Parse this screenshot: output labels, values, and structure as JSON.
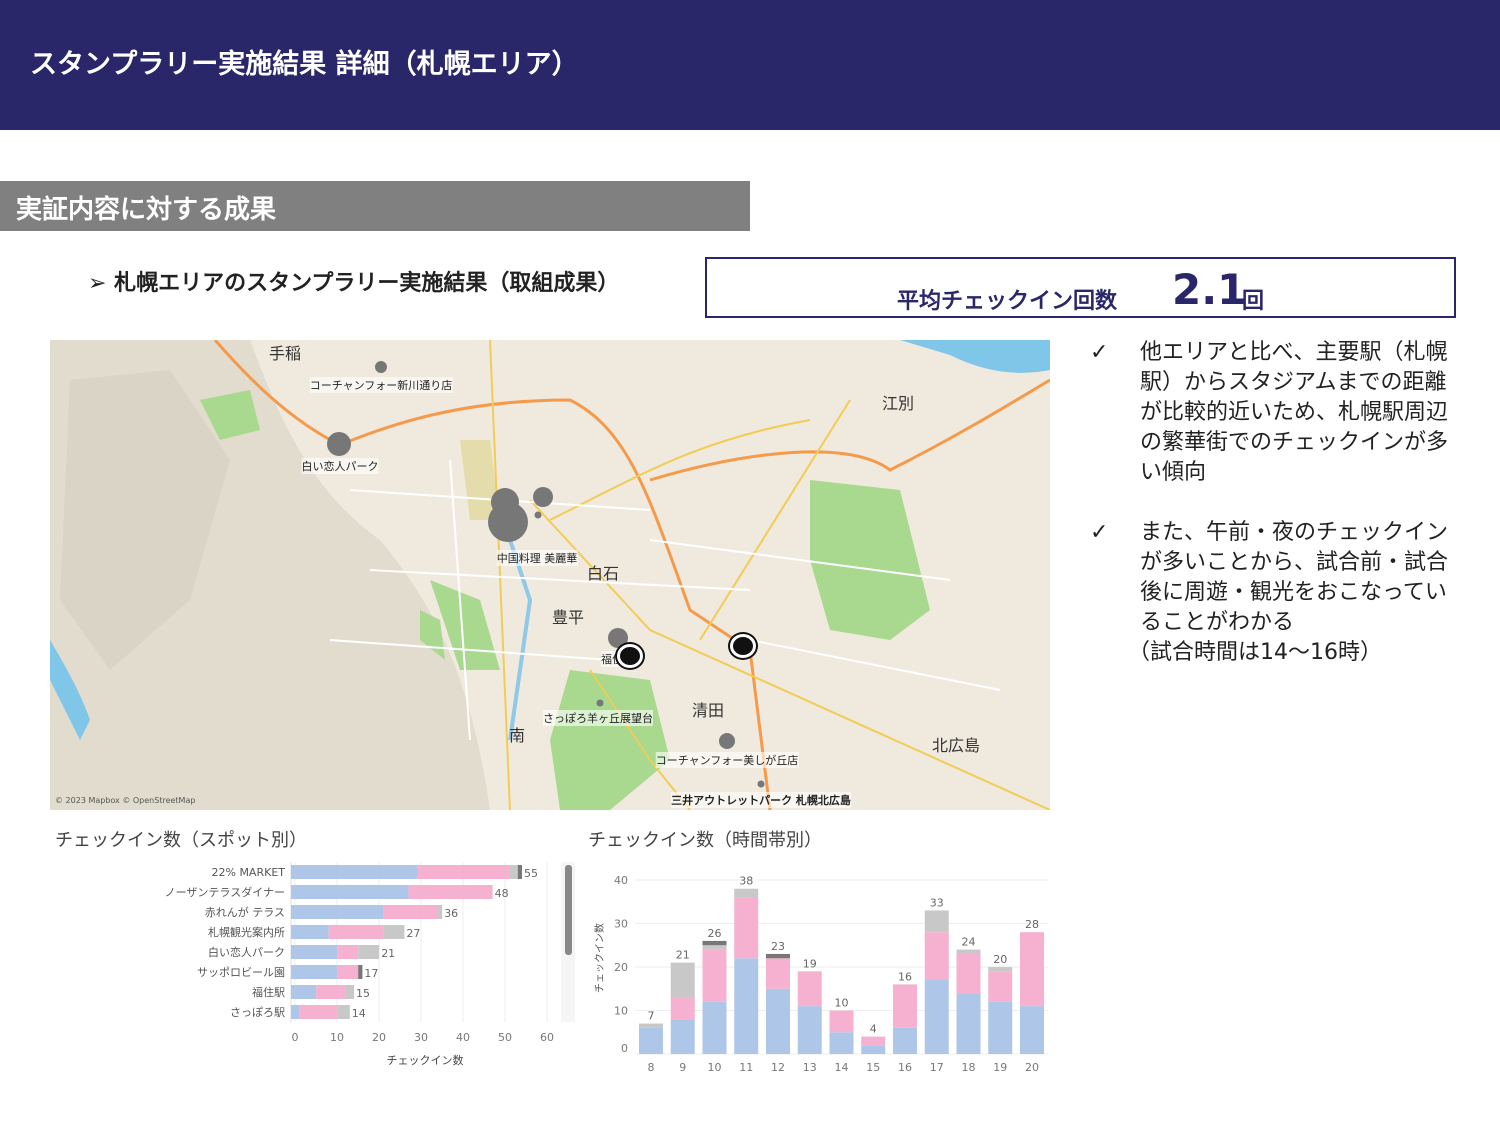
{
  "header": {
    "title": "スタンプラリー実施結果 詳細（札幌エリア）"
  },
  "section": {
    "title": "実証内容に対する成果"
  },
  "subtitle": "➢ 札幌エリアのスタンプラリー実施結果（取組成果）",
  "average": {
    "label": "平均チェックイン回数",
    "value": "2.1",
    "unit": "回"
  },
  "map": {
    "places": [
      "手稲",
      "江別",
      "白石",
      "豊平",
      "清田",
      "南",
      "北広島"
    ],
    "spots": [
      "コーチャンフォー新川通り店",
      "白い恋人パーク",
      "中国料理 美麗華",
      "福住",
      "さっぽろ羊ヶ丘展望台",
      "コーチャンフォー美しが丘店",
      "三井アウトレットパーク 札幌北広島"
    ],
    "copyright": "© 2023 Mapbox © OpenStreetMap"
  },
  "notes": [
    {
      "icon": "✓",
      "text": "他エリアと比べ、主要駅（札幌駅）からスタジアムまでの距離が比較的近いため、札幌駅周辺の繁華街でのチェックインが多い傾向"
    },
    {
      "icon": "✓",
      "text": "また、午前・夜のチェックインが多いことから、試合前・試合後に周遊・観光をおこなっていることがわかる",
      "tail": "（試合時間は14〜16時）"
    }
  ],
  "colors": {
    "blue": "#aec6e8",
    "pink": "#f5b1cf",
    "gray": "#c8c8c8",
    "dark": "#777777"
  },
  "chart_data": [
    {
      "type": "bar",
      "orientation": "horizontal",
      "stacked": true,
      "title": "チェックイン数（スポット別）",
      "xlabel": "チェックイン数",
      "xlim": [
        0,
        60
      ],
      "xticks": [
        0,
        10,
        20,
        30,
        40,
        50,
        60
      ],
      "categories": [
        "22% MARKET",
        "ノーザンテラスダイナー",
        "赤れんが テラス",
        "札幌観光案内所",
        "白い恋人パーク",
        "サッポロビール園",
        "福住駅",
        "さっぽろ駅"
      ],
      "totals": [
        55,
        48,
        36,
        27,
        21,
        17,
        15,
        14
      ],
      "series": [
        {
          "name": "blue",
          "values": [
            30,
            28,
            22,
            9,
            11,
            11,
            6,
            2
          ]
        },
        {
          "name": "pink",
          "values": [
            22,
            20,
            13,
            13,
            5,
            5,
            7,
            9
          ]
        },
        {
          "name": "gray",
          "values": [
            2,
            0,
            1,
            5,
            5,
            0,
            2,
            3
          ]
        },
        {
          "name": "dark",
          "values": [
            1,
            0,
            0,
            0,
            0,
            1,
            0,
            0
          ]
        }
      ]
    },
    {
      "type": "bar",
      "stacked": true,
      "title": "チェックイン数（時間帯別）",
      "ylabel": "チェックイン数",
      "ylim": [
        0,
        40
      ],
      "yticks": [
        0,
        10,
        20,
        30,
        40
      ],
      "categories": [
        "8",
        "9",
        "10",
        "11",
        "12",
        "13",
        "14",
        "15",
        "16",
        "17",
        "18",
        "19",
        "20"
      ],
      "totals": [
        7,
        21,
        26,
        38,
        23,
        19,
        10,
        4,
        16,
        33,
        24,
        20,
        28
      ],
      "series": [
        {
          "name": "blue",
          "values": [
            6,
            8,
            12,
            22,
            15,
            11,
            5,
            2,
            6,
            17,
            14,
            12,
            11
          ]
        },
        {
          "name": "pink",
          "values": [
            0,
            5,
            12,
            14,
            7,
            8,
            5,
            2,
            10,
            11,
            9,
            7,
            17
          ]
        },
        {
          "name": "gray",
          "values": [
            1,
            8,
            1,
            2,
            0,
            0,
            0,
            0,
            0,
            5,
            1,
            1,
            0
          ]
        },
        {
          "name": "dark",
          "values": [
            0,
            0,
            1,
            0,
            1,
            0,
            0,
            0,
            0,
            0,
            0,
            0,
            0
          ]
        }
      ]
    }
  ]
}
